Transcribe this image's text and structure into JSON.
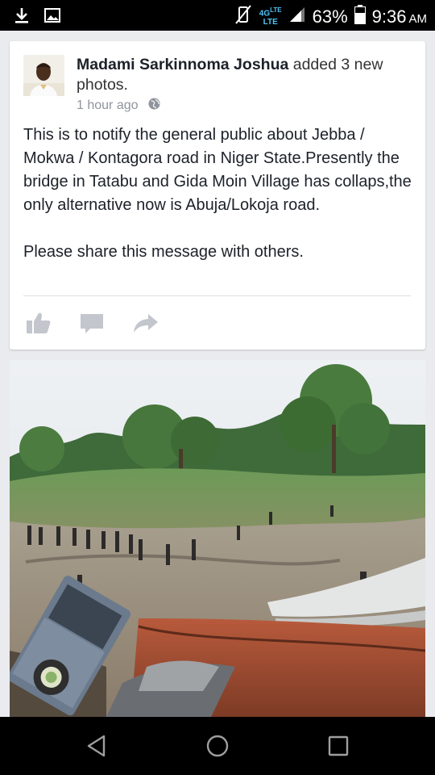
{
  "status_bar": {
    "left_icons": [
      "download-icon",
      "image-icon"
    ],
    "right_icons": [
      "vibrate-mute-icon",
      "signal-icon",
      "battery-icon"
    ],
    "network_top": "4G",
    "network_top_sup": "LTE",
    "network_bottom": "LTE",
    "battery": "63%",
    "time": "9:36",
    "ampm": "AM"
  },
  "post": {
    "author": "Madami Sarkinnoma Joshua",
    "action": " added 3 new photos.",
    "timestamp": "1 hour ago",
    "privacy_icon": "globe-icon",
    "body": [
      "This is to notify the general public about Jebba / Mokwa / Kontagora road in Niger State.Presently the bridge in Tatabu and Gida Moin  Village has collaps,the only alternative now is Abuja/Lokoja road.",
      "Please share this message with others."
    ],
    "actions": [
      "like-icon",
      "comment-icon",
      "share-icon"
    ]
  },
  "navigation": {
    "buttons": [
      "back-icon",
      "home-icon",
      "recents-icon"
    ]
  },
  "colors": {
    "background": "#e9ebee",
    "card": "#ffffff",
    "text": "#1d2129",
    "muted": "#90949c",
    "action_icon": "#c3c6cc",
    "status_bar": "#000000"
  }
}
